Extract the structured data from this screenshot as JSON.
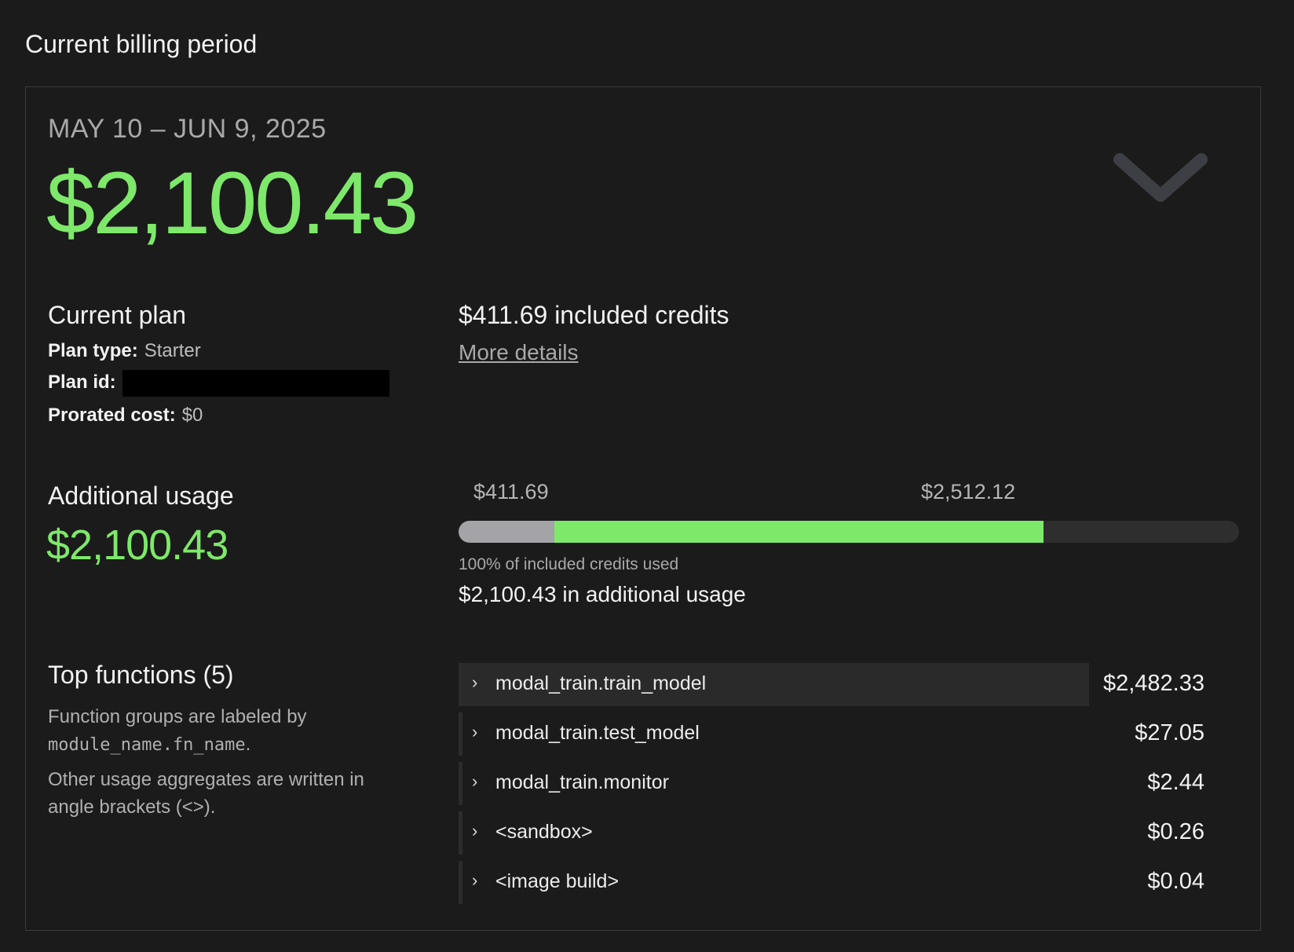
{
  "section_title": "Current billing period",
  "billing": {
    "date_range": "MAY 10 – JUN 9, 2025",
    "total": "$2,100.43"
  },
  "plan": {
    "title": "Current plan",
    "type_label": "Plan type:",
    "type_value": "Starter",
    "id_label": "Plan id:",
    "prorated_label": "Prorated cost:",
    "prorated_value": "$0"
  },
  "credits": {
    "title": "$411.69 included credits",
    "more_details": "More details"
  },
  "additional": {
    "title": "Additional usage",
    "amount": "$2,100.43"
  },
  "usage_bar": {
    "label_included": "$411.69",
    "label_total": "$2,512.12",
    "included_fraction": 0.123,
    "used_fraction": 0.75,
    "pct_text": "100% of included credits used",
    "additional_text": "$2,100.43 in additional usage",
    "colors": {
      "included": "#a4a4a8",
      "additional": "#7ee86a",
      "track": "#2e2e2f"
    }
  },
  "functions": {
    "title": "Top functions (5)",
    "desc1_pre": "Function groups are labeled by",
    "desc1_code": "module_name.fn_name",
    "desc1_post": ".",
    "desc2": "Other usage aggregates are written in angle brackets (<>).",
    "items": [
      {
        "name": "modal_train.train_model",
        "cost": "$2,482.33",
        "share": 0.82
      },
      {
        "name": "modal_train.test_model",
        "cost": "$27.05",
        "share": 0.0
      },
      {
        "name": "modal_train.monitor",
        "cost": "$2.44",
        "share": 0.0
      },
      {
        "name": "<sandbox>",
        "cost": "$0.26",
        "share": 0.0
      },
      {
        "name": "<image build>",
        "cost": "$0.04",
        "share": 0.0
      }
    ]
  },
  "icons": {
    "expand": "chevron-down-icon",
    "row_expand": "chevron-right-icon"
  },
  "colors": {
    "accent_green": "#7ee86a",
    "background": "#1b1b1b"
  }
}
